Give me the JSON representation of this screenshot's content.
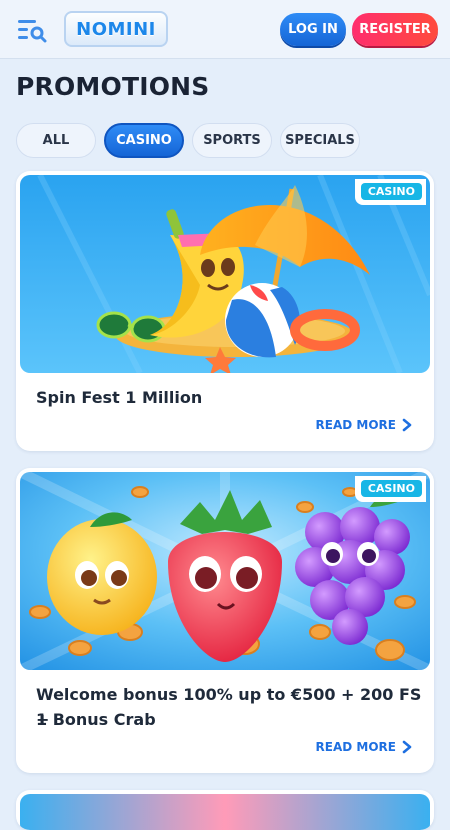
{
  "header": {
    "logo_text": "NOMINI",
    "login_label": "LOG IN",
    "register_label": "REGISTER"
  },
  "page": {
    "title": "PROMOTIONS"
  },
  "tabs": [
    {
      "label": "ALL",
      "active": false
    },
    {
      "label": "CASINO",
      "active": true
    },
    {
      "label": "SPORTS",
      "active": false
    },
    {
      "label": "SPECIALS",
      "active": false
    }
  ],
  "promotions": [
    {
      "badge": "CASINO",
      "title": "Spin Fest 1 Million",
      "read_more": "READ MORE"
    },
    {
      "badge": "CASINO",
      "title_line1": "Welcome bonus 100% up to €500 + 200 FS +",
      "title_line2": "1 Bonus Crab",
      "read_more": "READ MORE"
    }
  ],
  "colors": {
    "accent": "#1d6fe3",
    "register": "#ff3060",
    "badge": "#17b6e6"
  }
}
